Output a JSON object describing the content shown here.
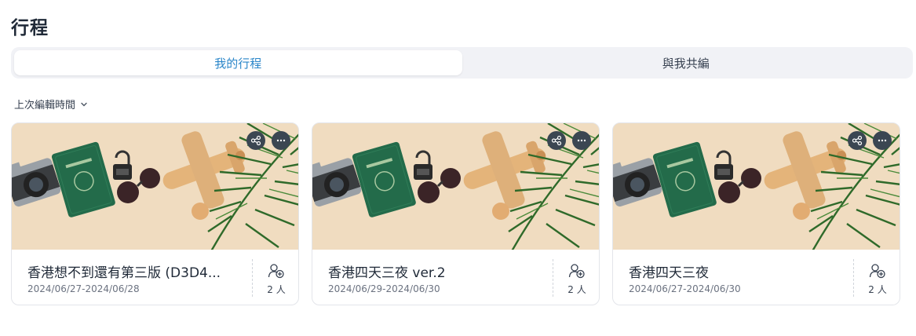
{
  "page": {
    "title": "行程"
  },
  "tabs": [
    {
      "label": "我的行程",
      "active": true
    },
    {
      "label": "與我共編",
      "active": false
    }
  ],
  "sort": {
    "label": "上次編輯時間"
  },
  "trips": [
    {
      "title": "香港想不到還有第三版 (D3D4...",
      "dates": "2024/06/27-2024/06/28",
      "members": "2 人"
    },
    {
      "title": "香港四天三夜 ver.2",
      "dates": "2024/06/29-2024/06/30",
      "members": "2 人"
    },
    {
      "title": "香港四天三夜",
      "dates": "2024/06/27-2024/06/30",
      "members": "2 人"
    }
  ],
  "colors": {
    "accent": "#2a86c9",
    "action_button": "#3b4652",
    "image_background": "#f0dcc0"
  }
}
